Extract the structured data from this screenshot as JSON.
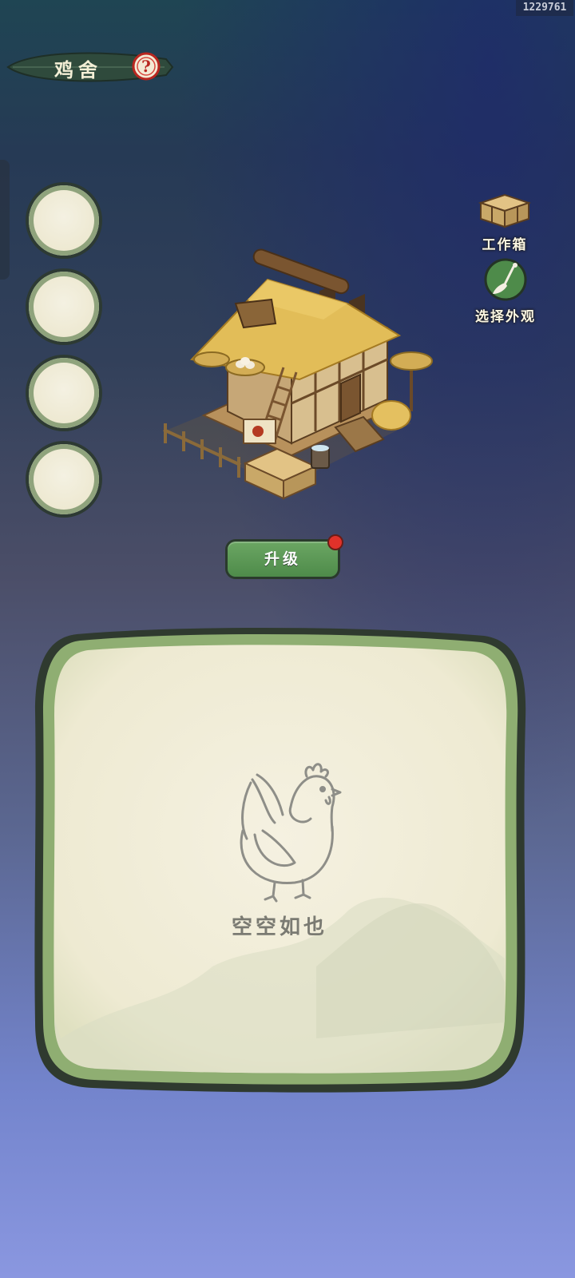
{
  "watermark_id": "1229761",
  "header": {
    "title": "鸡舍",
    "help_glyph": "?"
  },
  "slots": [
    {
      "id": 1,
      "state": "empty"
    },
    {
      "id": 2,
      "state": "empty"
    },
    {
      "id": 3,
      "state": "empty"
    },
    {
      "id": 4,
      "state": "empty"
    }
  ],
  "right_menu": {
    "toolbox_label": "工作箱",
    "appearance_label": "选择外观"
  },
  "upgrade": {
    "label": "升级",
    "has_notification": true
  },
  "panel": {
    "empty_text": "空空如也"
  },
  "colors": {
    "accent_green": "#4e8b4a",
    "notification_red": "#e0322a",
    "paper": "#f1eddb",
    "panel_border": "#8fae72"
  },
  "icons": [
    "help-icon",
    "toolbox-chest-icon",
    "brush-icon",
    "chicken-illustration"
  ]
}
